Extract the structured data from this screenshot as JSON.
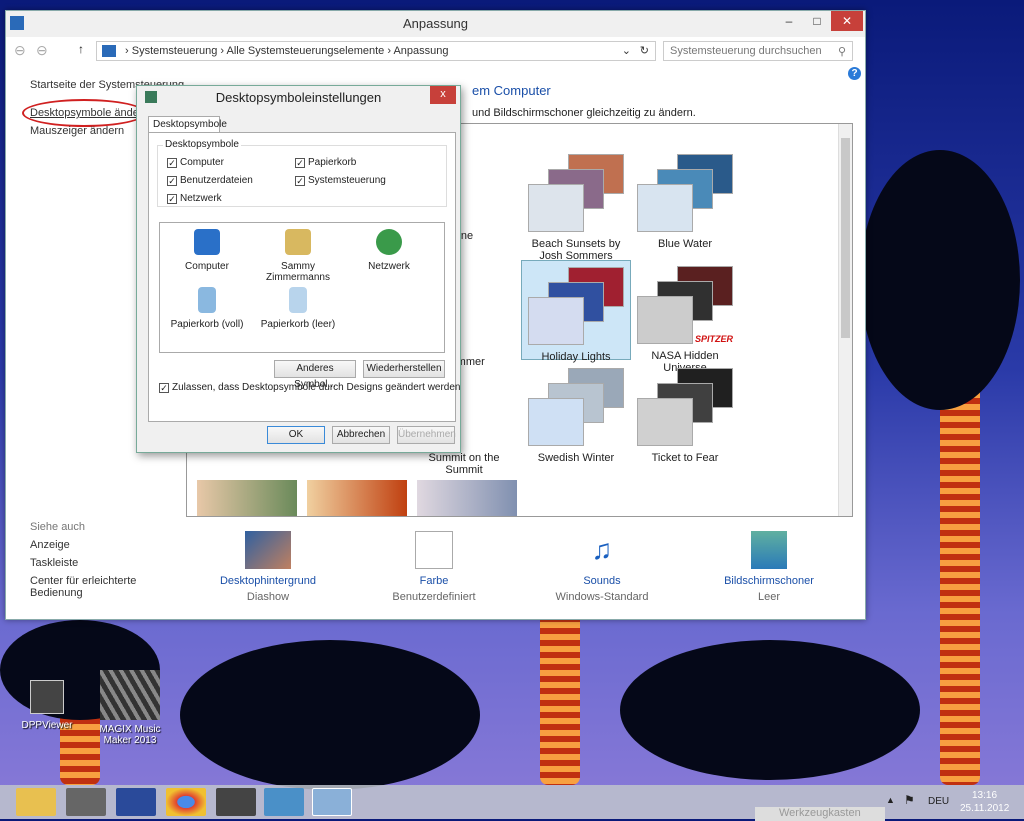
{
  "window": {
    "title": "Anpassung",
    "minimize": "–",
    "maximize": "□",
    "close": "✕"
  },
  "address": {
    "crumbs": [
      "Systemsteuerung",
      "Alle Systemsteuerungselemente",
      "Anpassung"
    ],
    "separator": "›",
    "search_placeholder": "Systemsteuerung durchsuchen"
  },
  "nav": {
    "home": "Startseite der Systemsteuerung",
    "desktop_icons": "Desktopsymbole ändern",
    "mouse": "Mauszeiger ändern",
    "see_also": "Siehe auch",
    "links": [
      "Anzeige",
      "Taskleiste",
      "Center für erleichterte Bedienung"
    ]
  },
  "main": {
    "heading_fragment": "em Computer",
    "desc_fragment": "und Bildschirmschoner gleichzeitig zu ändern.",
    "themes": [
      {
        "label": "ane"
      },
      {
        "label": "Beach Sunsets by Josh Sommers"
      },
      {
        "label": "Blue Water"
      },
      {
        "label": "Summer"
      },
      {
        "label": "Holiday Lights"
      },
      {
        "label": "NASA Hidden Universe"
      },
      {
        "label": "Summit on the Summit"
      },
      {
        "label": "Swedish Winter"
      },
      {
        "label": "Ticket to Fear"
      }
    ],
    "spitzer": "SPITZER",
    "bottom": [
      {
        "label": "Desktophintergrund",
        "value": "Diashow"
      },
      {
        "label": "Farbe",
        "value": "Benutzerdefiniert"
      },
      {
        "label": "Sounds",
        "value": "Windows-Standard"
      },
      {
        "label": "Bildschirmschoner",
        "value": "Leer"
      }
    ]
  },
  "dialog": {
    "title": "Desktopsymboleinstellungen",
    "close": "x",
    "tab": "Desktopsymbole",
    "group": "Desktopsymbole",
    "checks": [
      {
        "label": "Computer",
        "checked": true
      },
      {
        "label": "Papierkorb",
        "checked": true
      },
      {
        "label": "Benutzerdateien",
        "checked": true
      },
      {
        "label": "Systemsteuerung",
        "checked": true
      },
      {
        "label": "Netzwerk",
        "checked": true
      }
    ],
    "icons": [
      "Computer",
      "Sammy Zimmermanns",
      "Netzwerk",
      "Papierkorb (voll)",
      "Papierkorb (leer)"
    ],
    "change_icon": "Anderes Symbol...",
    "restore": "Wiederherstellen",
    "allow": "Zulassen, dass Desktopsymbole durch Designs geändert werden",
    "allow_checked": true,
    "ok": "OK",
    "cancel": "Abbrechen",
    "apply": "Übernehmen"
  },
  "desktop": {
    "icons": [
      "DPPViewer",
      "MAGIX Music Maker 2013"
    ]
  },
  "taskbar": {
    "lang": "DEU",
    "time": "13:16",
    "date": "25.11.2012",
    "tooltip": "Werkzeugkasten"
  },
  "colors": {
    "link": "#1a4fa8",
    "close_red": "#c7403a",
    "annotation": "#d02020"
  }
}
